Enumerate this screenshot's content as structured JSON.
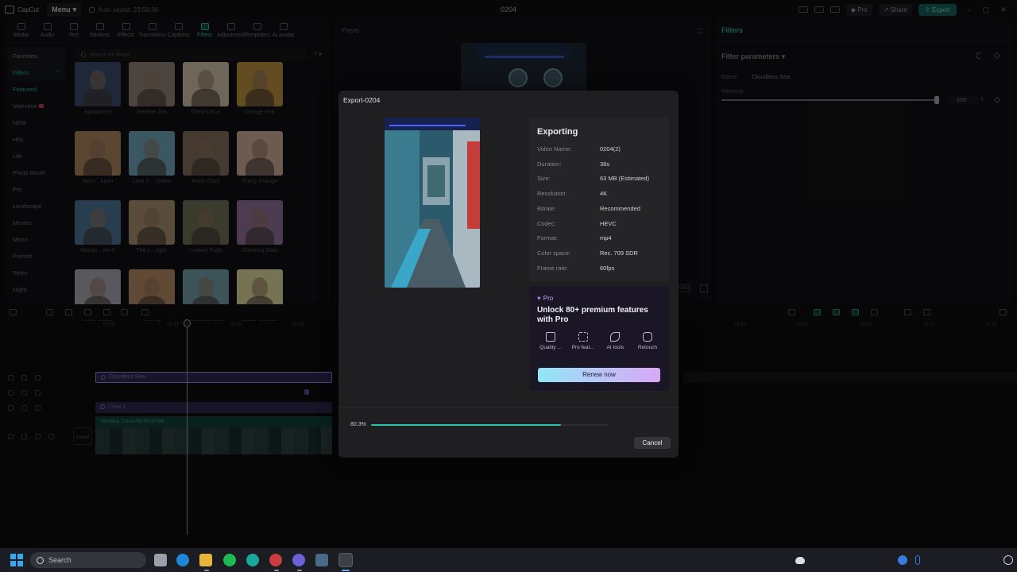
{
  "app": {
    "logo": "CapCut",
    "menu_label": "Menu",
    "autosave": "Auto saved: 23:59:38",
    "project_title": "0204",
    "pro_label": "Pro",
    "share_label": "Share",
    "export_label": "Export",
    "minimize": "–",
    "maximize": "▢",
    "close": "✕"
  },
  "toolbar": [
    {
      "label": "Media",
      "icon": "media-icon"
    },
    {
      "label": "Audio",
      "icon": "audio-icon"
    },
    {
      "label": "Text",
      "icon": "text-icon"
    },
    {
      "label": "Stickers",
      "icon": "stickers-icon"
    },
    {
      "label": "Effects",
      "icon": "effects-icon"
    },
    {
      "label": "Transitions",
      "icon": "transitions-icon"
    },
    {
      "label": "Captions",
      "icon": "captions-icon"
    },
    {
      "label": "Filters",
      "icon": "filters-icon",
      "active": true
    },
    {
      "label": "Adjustment",
      "icon": "adjustment-icon"
    },
    {
      "label": "Templates",
      "icon": "templates-icon"
    },
    {
      "label": "AI avatar",
      "icon": "ai-avatar-icon"
    }
  ],
  "categories": [
    "Favorites",
    "Filters",
    "Featured",
    "Valentine",
    "NEW",
    "Hits",
    "Life",
    "Photo Booth",
    "Pet",
    "Landscape",
    "Movies",
    "Mono",
    "Portrait",
    "Retro",
    "Night"
  ],
  "search": {
    "placeholder": "Search for filters"
  },
  "filters": [
    {
      "name": "Speakeasy",
      "color": "#3a4a66"
    },
    {
      "name": "Reserie 20s",
      "color": "#8a7e74"
    },
    {
      "name": "Dried Citrus",
      "color": "#c7bba2"
    },
    {
      "name": "Vintage Pink",
      "color": "#b58a3c"
    },
    {
      "name": "Moro…harm",
      "color": "#a6805a"
    },
    {
      "name": "Lake if… Green",
      "color": "#6ca0b2"
    },
    {
      "name": "Retro Cozy",
      "color": "#7d6a58"
    },
    {
      "name": "Fuzzy Orange",
      "color": "#c6a494"
    },
    {
      "name": "Mango…ion II",
      "color": "#4a7292"
    },
    {
      "name": "The L…nger",
      "color": "#a28a6a"
    },
    {
      "name": "Lowkey Fade",
      "color": "#6a6a52"
    },
    {
      "name": "Glittering Gala",
      "color": "#8c6c94"
    },
    {
      "name": "Retro Studio",
      "color": "#a3a3a9",
      "download": true
    },
    {
      "name": "Serang",
      "color": "#b08662",
      "download": true
    },
    {
      "name": "Cloudless Sea",
      "color": "#6d9aa0"
    },
    {
      "name": "Butter Cheese",
      "color": "#d7d09a"
    }
  ],
  "player": {
    "title": "Player",
    "ratio": "Ratio"
  },
  "right_panel": {
    "header": "Filters",
    "section": "Filter parameters",
    "name_label": "Name",
    "name_value": "Cloudless Sea",
    "intensity_label": "Intensity",
    "intensity_value": "100",
    "intensity_level": 1.0
  },
  "timeline": {
    "ruler": [
      "00:00",
      "00:10",
      "00:20",
      "00:30",
      "01:40",
      "01:50",
      "02:00",
      "02:10",
      "02:20"
    ],
    "filter_clip": "Cloudless Sea",
    "clear_clip": "Clear II",
    "video_clip": "Timeline 1.mov   00:00:37:08",
    "cover_label": "Cover"
  },
  "export_dialog": {
    "title": "Export-0204",
    "status": "Exporting",
    "rows": [
      {
        "k": "Video Name:",
        "v": "0204(2)"
      },
      {
        "k": "Duration:",
        "v": "38s"
      },
      {
        "k": "Size:",
        "v": "63 MB (Estimated)"
      },
      {
        "k": "Resolution:",
        "v": "4K"
      },
      {
        "k": "Bitrate:",
        "v": "Recommended"
      },
      {
        "k": "Codec:",
        "v": "HEVC"
      },
      {
        "k": "Format:",
        "v": "mp4"
      },
      {
        "k": "Color space:",
        "v": "Rec. 709 SDR"
      },
      {
        "k": "Frame rate:",
        "v": "60fps"
      }
    ],
    "pro": {
      "tag": "Pro",
      "headline": "Unlock 80+ premium features with Pro",
      "features": [
        "Quality ...",
        "Pro feat...",
        "AI tools",
        "Retouch"
      ],
      "renew": "Renew now"
    },
    "progress_text": "80.3%",
    "progress": 0.803,
    "cancel": "Cancel"
  },
  "taskbar": {
    "search": "Search",
    "apps": [
      "file-explorer-icon",
      "edge-icon",
      "folder-icon",
      "spotify-icon",
      "clipchamp-icon",
      "chrome-icon",
      "discord-icon",
      "davinci-icon",
      "capcut-icon"
    ]
  },
  "colors": {
    "accent": "#2aa798",
    "progress": "#2cc2b0",
    "filter_clip": "#2b2750",
    "video_clip": "#0f3c36"
  }
}
